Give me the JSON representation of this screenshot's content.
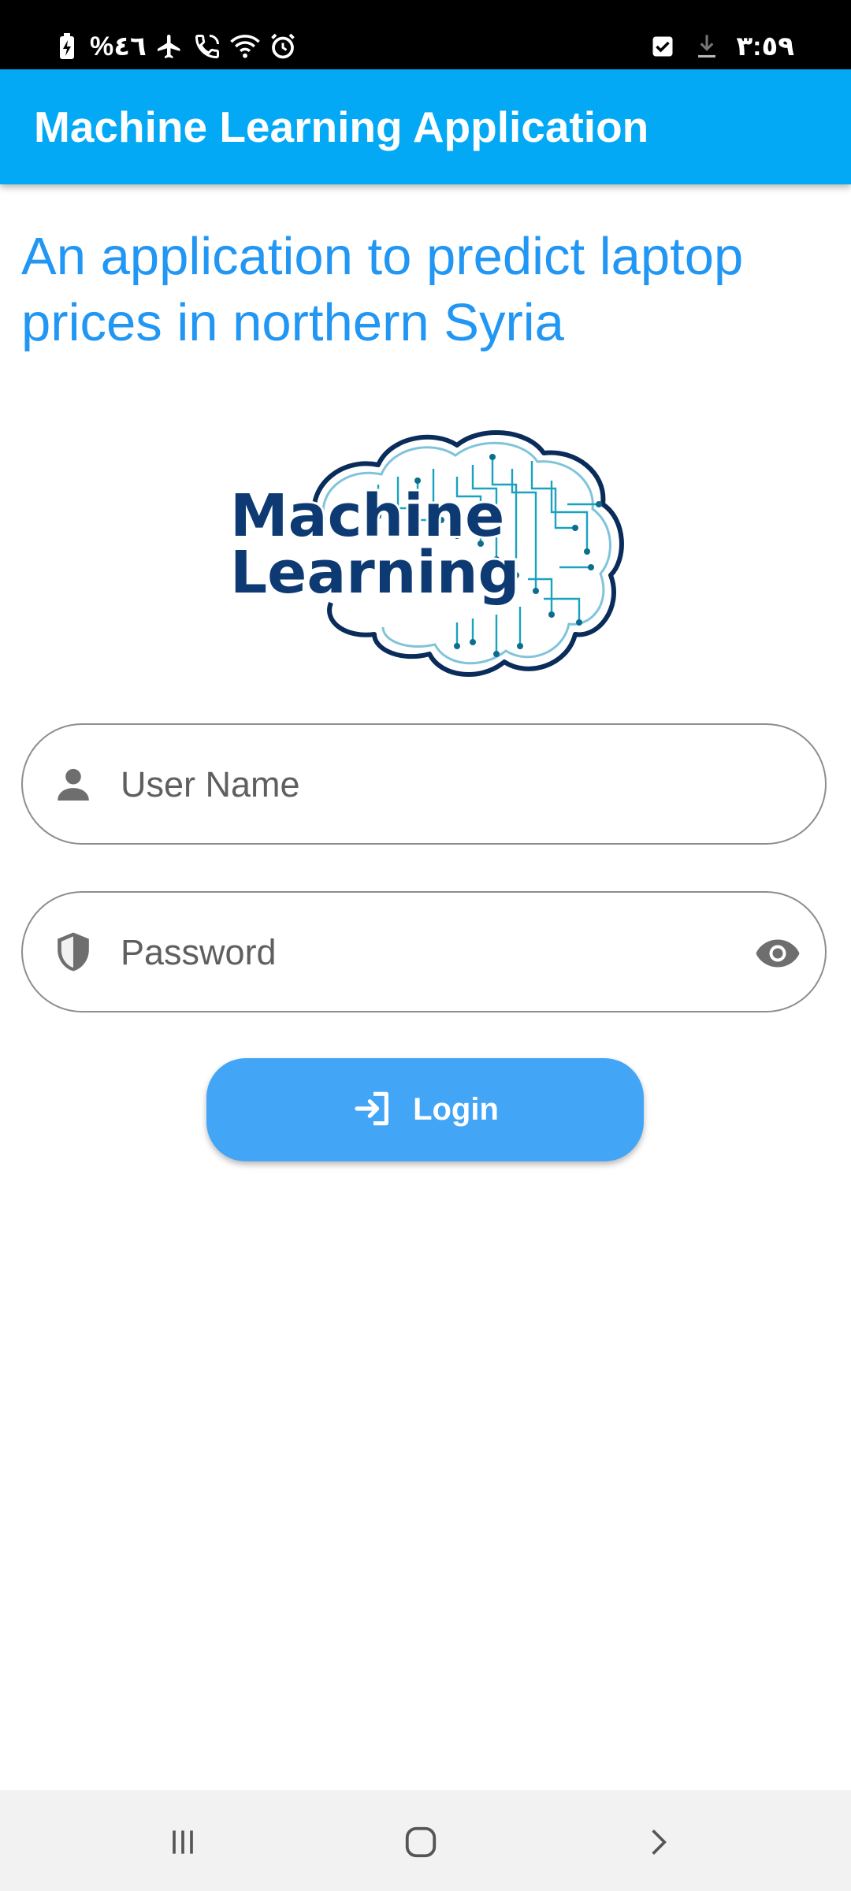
{
  "status_bar": {
    "battery_text": "%٤٦",
    "time": "٣:٥٩",
    "icons": [
      "battery-saver-icon",
      "airplane-icon",
      "wifi-calling-icon",
      "wifi-icon",
      "alarm-icon",
      "checkbox-notification-icon",
      "download-icon"
    ]
  },
  "app_bar": {
    "title": "Machine Learning Application",
    "color": "#03A9F4"
  },
  "headline": "An application to predict laptop prices in northern Syria",
  "logo": {
    "line1": "Machine",
    "line2": "Learning"
  },
  "form": {
    "username": {
      "placeholder": "User Name",
      "value": "",
      "icon": "person-icon"
    },
    "password": {
      "placeholder": "Password",
      "value": "",
      "icon": "shield-icon",
      "toggle_icon": "eye-icon"
    },
    "login_button": {
      "label": "Login",
      "icon": "login-icon",
      "color": "#42A5F5"
    }
  },
  "nav_bar": {
    "buttons": [
      "recent-apps-icon",
      "home-icon",
      "back-icon"
    ]
  }
}
